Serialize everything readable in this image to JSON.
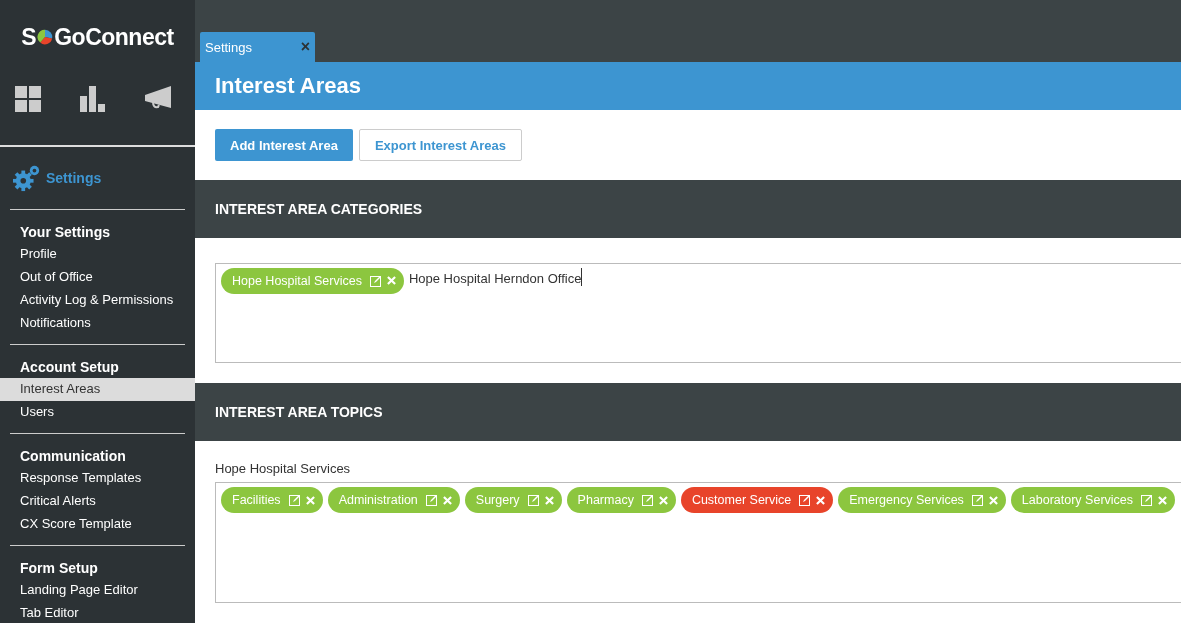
{
  "logo": {
    "before": "S",
    "after": "GoConnect"
  },
  "sidebar": {
    "section_title": "Settings",
    "groups": [
      {
        "title": "Your Settings",
        "items": [
          {
            "label": "Profile",
            "selected": false
          },
          {
            "label": "Out of Office",
            "selected": false
          },
          {
            "label": "Activity Log & Permissions",
            "selected": false
          },
          {
            "label": "Notifications",
            "selected": false
          }
        ]
      },
      {
        "title": "Account Setup",
        "items": [
          {
            "label": "Interest Areas",
            "selected": true
          },
          {
            "label": "Users",
            "selected": false
          }
        ]
      },
      {
        "title": "Communication",
        "items": [
          {
            "label": "Response Templates",
            "selected": false
          },
          {
            "label": "Critical Alerts",
            "selected": false
          },
          {
            "label": "CX Score Template",
            "selected": false
          }
        ]
      },
      {
        "title": "Form Setup",
        "items": [
          {
            "label": "Landing Page Editor",
            "selected": false
          },
          {
            "label": "Tab Editor",
            "selected": false
          }
        ]
      }
    ]
  },
  "tabs": [
    {
      "label": "Settings",
      "close": "×",
      "selected": true
    }
  ],
  "page_title": "Interest Areas",
  "buttons": [
    {
      "label": "Add Interest Area",
      "kind": "primary"
    },
    {
      "label": "Export Interest Areas",
      "kind": "secondary"
    }
  ],
  "categories": {
    "heading": "INTEREST AREA CATEGORIES",
    "tags": [
      {
        "label": "Hope Hospital Services",
        "selected": false
      }
    ],
    "value": "Hope Hospital Herndon Office"
  },
  "topics": {
    "heading": "INTEREST AREA TOPICS",
    "label": "Hope Hospital Services",
    "tags": [
      {
        "label": "Facilities",
        "selected": false
      },
      {
        "label": "Administration",
        "selected": false
      },
      {
        "label": "Surgery",
        "selected": false
      },
      {
        "label": "Pharmacy",
        "selected": false
      },
      {
        "label": "Customer Service",
        "selected": true
      },
      {
        "label": "Emergency Services",
        "selected": false
      },
      {
        "label": "Laboratory Services",
        "selected": false
      }
    ]
  }
}
